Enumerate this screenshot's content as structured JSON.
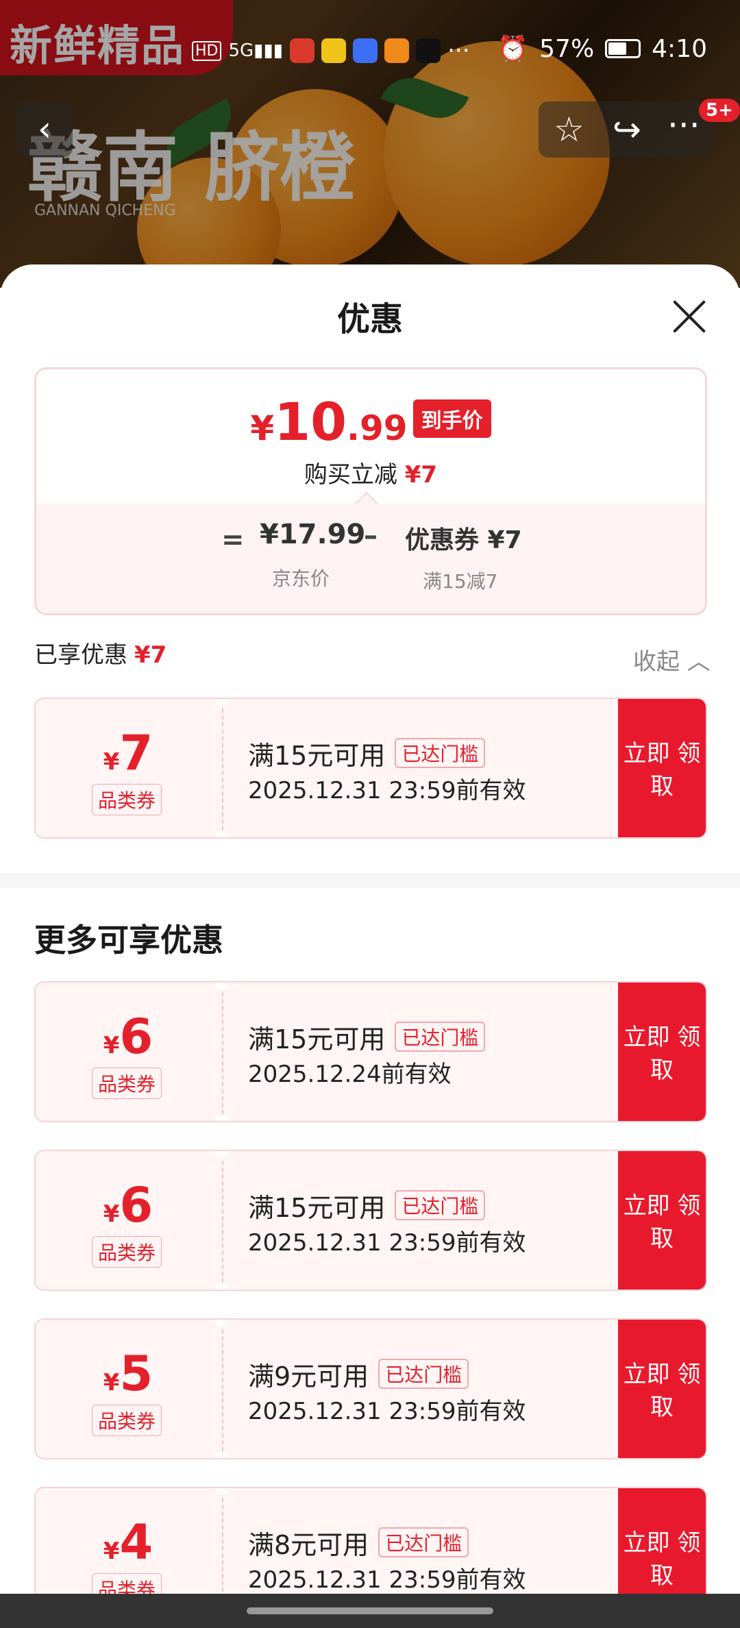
{
  "status": {
    "left_icons": [
      "HD",
      "5G",
      "signal"
    ],
    "battery": "57%",
    "time": "4:10",
    "dots": "···"
  },
  "background": {
    "banner_text": "新鲜精品",
    "big_text": "赣南 脐橙",
    "sub_text": "GANNAN QICHENG"
  },
  "nav": {
    "back": "‹",
    "star": "☆",
    "share": "↪",
    "more": "···",
    "badge": "5+"
  },
  "sheet": {
    "title": "优惠",
    "price": {
      "currency": "¥",
      "integer": "10",
      "decimal": ".99",
      "tag": "到手价"
    },
    "reduce_text": "购买立减",
    "reduce_amount": "¥7",
    "breakdown": {
      "eq": "=",
      "jd_price": "¥17.99",
      "jd_label": "京东价",
      "minus": "–",
      "coupon_value": "优惠券 ¥7",
      "coupon_label": "满15减7"
    },
    "enjoyed_label": "已享优惠",
    "enjoyed_amount": "¥7",
    "collapse_label": "收起 ︿",
    "more_title": "更多可享优惠"
  },
  "coupons": [
    {
      "amount": "7",
      "kind": "品类券",
      "condition": "满15元可用",
      "reached": "已达门槛",
      "expiry": "2025.12.31 23:59前有效",
      "button": "立即 领取"
    },
    {
      "amount": "6",
      "kind": "品类券",
      "condition": "满15元可用",
      "reached": "已达门槛",
      "expiry": "2025.12.24前有效",
      "button": "立即 领取"
    },
    {
      "amount": "6",
      "kind": "品类券",
      "condition": "满15元可用",
      "reached": "已达门槛",
      "expiry": "2025.12.31 23:59前有效",
      "button": "立即 领取"
    },
    {
      "amount": "5",
      "kind": "品类券",
      "condition": "满9元可用",
      "reached": "已达门槛",
      "expiry": "2025.12.31 23:59前有效",
      "button": "立即 领取"
    },
    {
      "amount": "4",
      "kind": "品类券",
      "condition": "满8元可用",
      "reached": "已达门槛",
      "expiry": "2025.12.31 23:59前有效",
      "button": "立即 领取"
    }
  ],
  "colors": {
    "accent": "#e4202b",
    "coupon_bg": "#fff5f5"
  }
}
